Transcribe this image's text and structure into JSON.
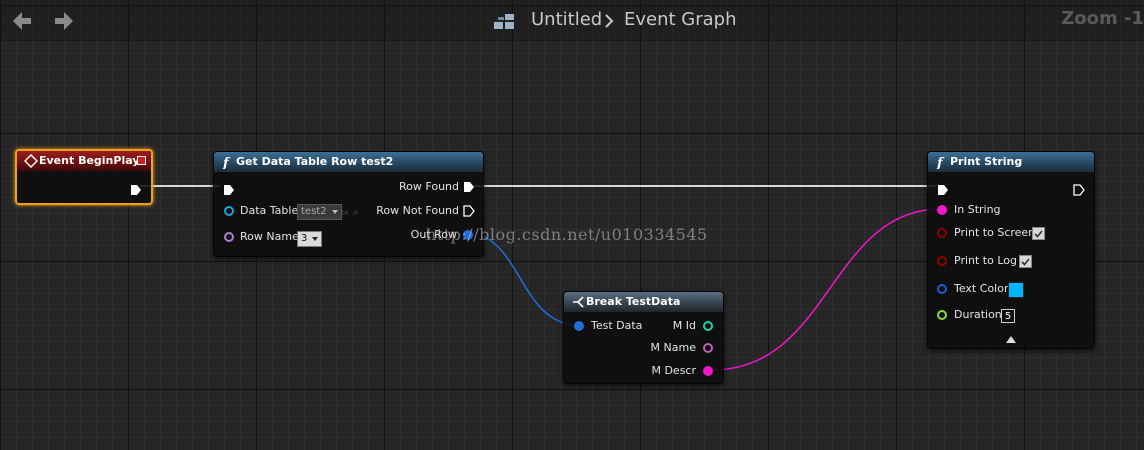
{
  "toolbar": {
    "back_icon": "back-arrow-icon",
    "forward_icon": "forward-arrow-icon"
  },
  "breadcrumb": {
    "icon": "blueprint-graph-icon",
    "asset": "Untitled",
    "graph": "Event Graph"
  },
  "zoom_label": "Zoom -1",
  "nodes": {
    "begin_play": {
      "title": "Event BeginPlay",
      "color": "#8e1616"
    },
    "get_row": {
      "title": "Get Data Table Row test2",
      "inputs": {
        "data_table_label": "Data Table",
        "data_table_value": "test2",
        "row_name_label": "Row Name",
        "row_name_value": "3"
      },
      "outputs": {
        "row_found": "Row Found",
        "row_not_found": "Row Not Found",
        "out_row": "Out Row"
      }
    },
    "break": {
      "title": "Break TestData",
      "input": "Test Data",
      "outputs": [
        "M Id",
        "M Name",
        "M Descr"
      ]
    },
    "print": {
      "title": "Print String",
      "in_string": "In String",
      "print_screen": "Print to Screen",
      "print_log": "Print to Log",
      "text_color": "Text Color",
      "text_color_value": "#00b7ff",
      "duration": "Duration",
      "duration_value": "5",
      "print_screen_checked": true,
      "print_log_checked": true
    }
  },
  "colors": {
    "exec_wire": "#d8d8d8",
    "struct_wire": "#1f6fd6",
    "string_wire": "#f018c6",
    "name_pin": "#b07cd1",
    "object_pin": "#1aa7d8",
    "int_pin": "#1fd1a6",
    "bool_pin": "#8f0000",
    "float_pin": "#8fd44a"
  },
  "watermark": "http://blog.csdn.net/u010334545"
}
